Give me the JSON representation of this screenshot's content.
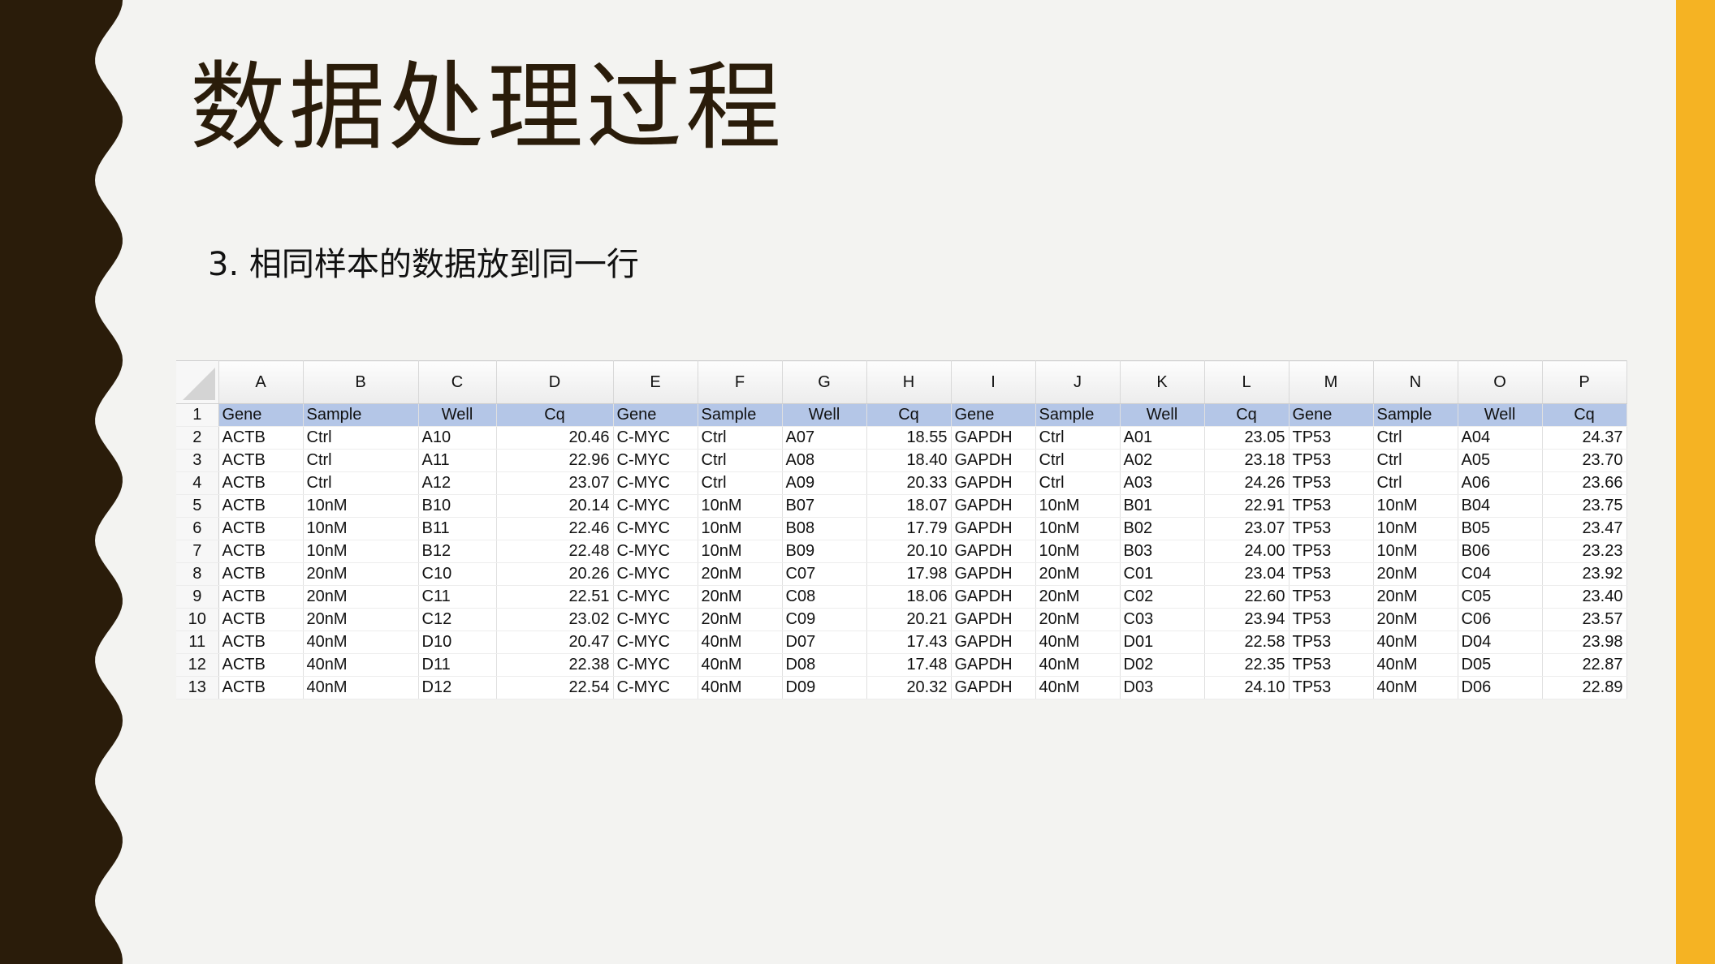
{
  "slide": {
    "title": "数据处理过程",
    "subtitle": "3. 相同样本的数据放到同一行",
    "colors": {
      "left_band": "#2a1c0a",
      "right_bar": "#f5b323",
      "header_fill": "#b4c6e7",
      "background": "#f3f3f1"
    }
  },
  "sheet": {
    "columns": [
      "A",
      "B",
      "C",
      "D",
      "E",
      "F",
      "G",
      "H",
      "I",
      "J",
      "K",
      "L",
      "M",
      "N",
      "O",
      "P"
    ],
    "rows": [
      {
        "n": "1",
        "cells": [
          "Gene",
          "Sample",
          "Well",
          "Cq",
          "Gene",
          "Sample",
          "Well",
          "Cq",
          "Gene",
          "Sample",
          "Well",
          "Cq",
          "Gene",
          "Sample",
          "Well",
          "Cq"
        ]
      },
      {
        "n": "2",
        "cells": [
          "ACTB",
          "Ctrl",
          "A10",
          "20.46",
          "C-MYC",
          "Ctrl",
          "A07",
          "18.55",
          "GAPDH",
          "Ctrl",
          "A01",
          "23.05",
          "TP53",
          "Ctrl",
          "A04",
          "24.37"
        ]
      },
      {
        "n": "3",
        "cells": [
          "ACTB",
          "Ctrl",
          "A11",
          "22.96",
          "C-MYC",
          "Ctrl",
          "A08",
          "18.40",
          "GAPDH",
          "Ctrl",
          "A02",
          "23.18",
          "TP53",
          "Ctrl",
          "A05",
          "23.70"
        ]
      },
      {
        "n": "4",
        "cells": [
          "ACTB",
          "Ctrl",
          "A12",
          "23.07",
          "C-MYC",
          "Ctrl",
          "A09",
          "20.33",
          "GAPDH",
          "Ctrl",
          "A03",
          "24.26",
          "TP53",
          "Ctrl",
          "A06",
          "23.66"
        ]
      },
      {
        "n": "5",
        "cells": [
          "ACTB",
          "10nM",
          "B10",
          "20.14",
          "C-MYC",
          "10nM",
          "B07",
          "18.07",
          "GAPDH",
          "10nM",
          "B01",
          "22.91",
          "TP53",
          "10nM",
          "B04",
          "23.75"
        ]
      },
      {
        "n": "6",
        "cells": [
          "ACTB",
          "10nM",
          "B11",
          "22.46",
          "C-MYC",
          "10nM",
          "B08",
          "17.79",
          "GAPDH",
          "10nM",
          "B02",
          "23.07",
          "TP53",
          "10nM",
          "B05",
          "23.47"
        ]
      },
      {
        "n": "7",
        "cells": [
          "ACTB",
          "10nM",
          "B12",
          "22.48",
          "C-MYC",
          "10nM",
          "B09",
          "20.10",
          "GAPDH",
          "10nM",
          "B03",
          "24.00",
          "TP53",
          "10nM",
          "B06",
          "23.23"
        ]
      },
      {
        "n": "8",
        "cells": [
          "ACTB",
          "20nM",
          "C10",
          "20.26",
          "C-MYC",
          "20nM",
          "C07",
          "17.98",
          "GAPDH",
          "20nM",
          "C01",
          "23.04",
          "TP53",
          "20nM",
          "C04",
          "23.92"
        ]
      },
      {
        "n": "9",
        "cells": [
          "ACTB",
          "20nM",
          "C11",
          "22.51",
          "C-MYC",
          "20nM",
          "C08",
          "18.06",
          "GAPDH",
          "20nM",
          "C02",
          "22.60",
          "TP53",
          "20nM",
          "C05",
          "23.40"
        ]
      },
      {
        "n": "10",
        "cells": [
          "ACTB",
          "20nM",
          "C12",
          "23.02",
          "C-MYC",
          "20nM",
          "C09",
          "20.21",
          "GAPDH",
          "20nM",
          "C03",
          "23.94",
          "TP53",
          "20nM",
          "C06",
          "23.57"
        ]
      },
      {
        "n": "11",
        "cells": [
          "ACTB",
          "40nM",
          "D10",
          "20.47",
          "C-MYC",
          "40nM",
          "D07",
          "17.43",
          "GAPDH",
          "40nM",
          "D01",
          "22.58",
          "TP53",
          "40nM",
          "D04",
          "23.98"
        ]
      },
      {
        "n": "12",
        "cells": [
          "ACTB",
          "40nM",
          "D11",
          "22.38",
          "C-MYC",
          "40nM",
          "D08",
          "17.48",
          "GAPDH",
          "40nM",
          "D02",
          "22.35",
          "TP53",
          "40nM",
          "D05",
          "22.87"
        ]
      },
      {
        "n": "13",
        "cells": [
          "ACTB",
          "40nM",
          "D12",
          "22.54",
          "C-MYC",
          "40nM",
          "D09",
          "20.32",
          "GAPDH",
          "40nM",
          "D03",
          "24.10",
          "TP53",
          "40nM",
          "D06",
          "22.89"
        ]
      }
    ]
  }
}
